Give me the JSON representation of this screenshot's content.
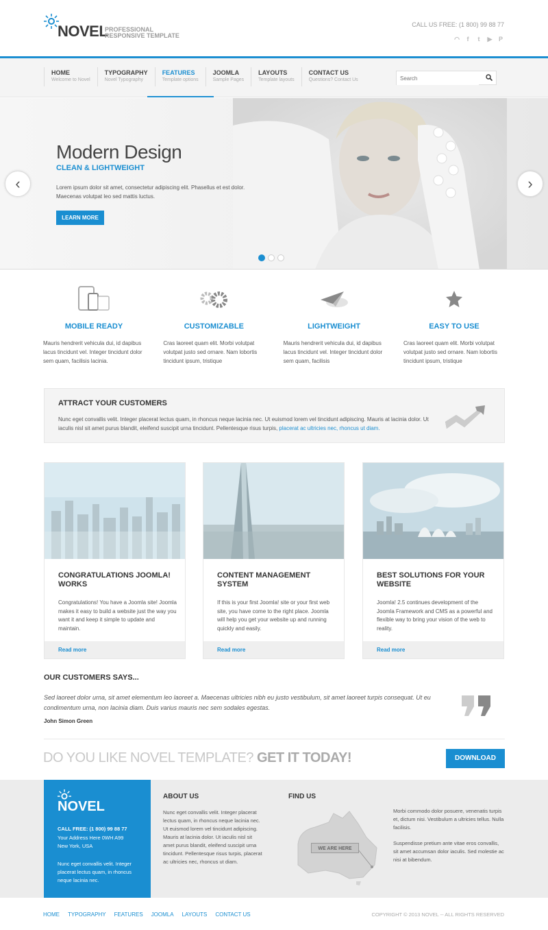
{
  "brand": {
    "name": "NOVEL",
    "tagline_1": "PROFESSIONAL",
    "tagline_2": "RESPONSIVE TEMPLATE",
    "accent": "#1a8ed1"
  },
  "header": {
    "call_us": "CALL US FREE:  (1 800) 99 88 77",
    "social": [
      "rss-icon",
      "facebook-icon",
      "twitter-icon",
      "youtube-icon",
      "pinterest-icon"
    ]
  },
  "nav": [
    {
      "title": "HOME",
      "sub": "Welcome to Novel"
    },
    {
      "title": "TYPOGRAPHY",
      "sub": "Novel Typography"
    },
    {
      "title": "FEATURES",
      "sub": "Template options"
    },
    {
      "title": "JOOMLA",
      "sub": "Sample Pages"
    },
    {
      "title": "LAYOUTS",
      "sub": "Template layouts"
    },
    {
      "title": "CONTACT US",
      "sub": "Questions? Contact Us"
    }
  ],
  "search": {
    "placeholder": "Search"
  },
  "hero": {
    "title": "Modern Design",
    "subtitle": "CLEAN & LIGHTWEIGHT",
    "text": "Lorem ipsum dolor sit amet, consectetur adipiscing elit. Phasellus et est dolor. Maecenas volutpat leo sed mattis luctus.",
    "button": "LEARN MORE",
    "prev": "‹",
    "next": "›"
  },
  "features": [
    {
      "title": "MOBILE READY",
      "icon": "mobile-devices-icon",
      "text": "Mauris hendrerit vehicula dui, id dapibus lacus tincidunt vel. Integer tincidunt dolor sem quam, facilisis lacinia."
    },
    {
      "title": "CUSTOMIZABLE",
      "icon": "gears-icon",
      "text": "Cras laoreet quam elit. Morbi volutpat volutpat justo sed ornare. Nam lobortis tincidunt ipsum, tristique"
    },
    {
      "title": "LIGHTWEIGHT",
      "icon": "paper-plane-icon",
      "text": "Mauris hendrerit vehicula dui, id dapibus lacus tincidunt vel. Integer tincidunt dolor sem quam, facilisis"
    },
    {
      "title": "EASY TO USE",
      "icon": "star-icon",
      "text": "Cras laoreet quam elit. Morbi volutpat volutpat justo sed ornare. Nam lobortis tincidunt ipsum, tristique"
    }
  ],
  "attract": {
    "title": "ATTRACT YOUR CUSTOMERS",
    "text": "Nunc eget convallis velit. Integer placerat lectus quam, in rhoncus neque lacinia nec. Ut euismod lorem vel tincidunt adipiscing. Mauris at lacinia dolor. Ut iaculis nisl sit amet purus blandit, eleifend suscipit urna tincidunt. Pellentesque risus turpis, ",
    "link": "placerat ac ultricies nec, rhoncus ut diam."
  },
  "cards": [
    {
      "title": "CONGRATULATIONS JOOMLA! WORKS",
      "text": "Congratulations! You have a Joomla site! Joomla makes it easy to build a website just the way you want it and keep it simple to update and maintain.",
      "more": "Read more"
    },
    {
      "title": "CONTENT MANAGEMENT SYSTEM",
      "text": "If this is your first Joomla! site or your first web site, you have come to the right place. Joomla will help you get your website up and running quickly and easily.",
      "more": "Read more"
    },
    {
      "title": "BEST SOLUTIONS FOR YOUR WEBSITE",
      "text": "Joomla! 2.5 continues development of the Joomla Framework and CMS as a powerful and flexible way to bring your vision of the web to reality.",
      "more": "Read more"
    }
  ],
  "customers": {
    "title": "OUR CUSTOMERS SAYS...",
    "quote": "Sed laoreet dolor urna, sit amet elementum leo laoreet a. Maecenas ultricies nibh eu justo vestibulum, sit amet laoreet turpis consequat. Ut eu condimentum urna, non lacinia diam. Duis varius mauris nec sem sodales egestas.",
    "author": "John Simon Green"
  },
  "cta": {
    "light": "DO YOU LIKE NOVEL TEMPLATE? ",
    "bold": "GET IT TODAY!",
    "button": "DOWNLOAD"
  },
  "footer": {
    "call": "CALL FREE:  (1 800) 99 88 77",
    "address1": "Your Address Here 0WH A99",
    "address2": "New York, USA",
    "blurb": "Nunc eget convallis velit. Integer placerat lectus quam, in rhoncus neque lacinia nec.",
    "about_title": "ABOUT US",
    "about_text": "Nunc eget convallis velit. Integer placerat lectus quam, in rhoncus neque lacinia nec. Ut euismod lorem vel tincidunt adipiscing. Mauris at lacinia dolor. Ut iaculis nisl sit amet purus blandit, eleifend suscipit urna tincidunt. Pellentesque risus turpis, placerat ac ultricies nec, rhoncus ut diam.",
    "find_title": "FIND US",
    "we_are_here": "WE ARE HERE",
    "right_1": "Morbi commodo dolor posuere, venenatis turpis et, dictum nisi. Vestibulum a ultricies tellus. Nulla facilisis.",
    "right_2": "Suspendisse pretium ante vitae eros convallis, sit amet accumsan dolor iaculis. Sed molestie ac nisi at bibendum."
  },
  "bottom_nav": [
    "HOME",
    "TYPOGRAPHY",
    "FEATURES",
    "JOOMLA",
    "LAYOUTS",
    "CONTACT US"
  ],
  "copyright": "COPYRIGHT © 2013 NOVEL -- ALL RIGHTS RESERVED"
}
